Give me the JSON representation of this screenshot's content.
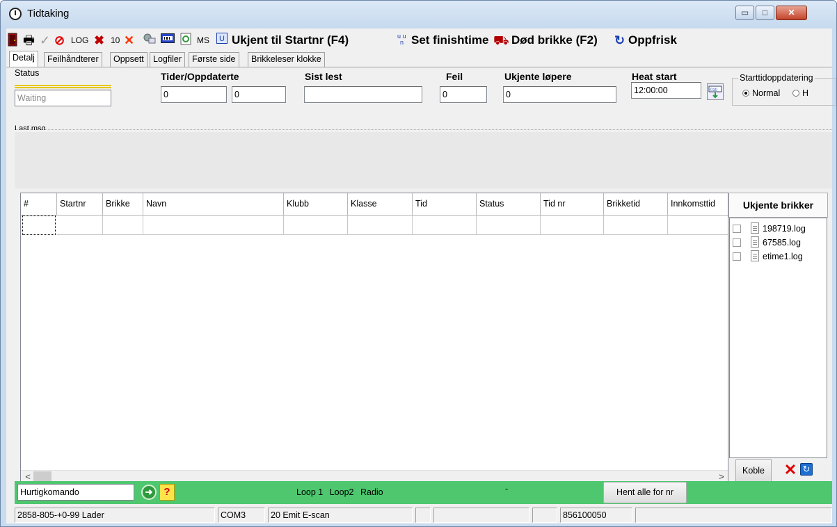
{
  "window": {
    "title": "Tidtaking",
    "controls": {
      "minimize": "▭",
      "maximize": "□",
      "close": "✕"
    }
  },
  "toolbar": {
    "log_label": "LOG",
    "ten_label": "10",
    "ms_label": "MS",
    "unknown_to_startnr_label": "Ukjent til Startnr (F4)",
    "set_finishtime_label": "Set finishtime",
    "dead_tag_label": "Død brikke (F2)",
    "refresh_label": "Oppfrisk",
    "icons": [
      "door-icon",
      "printer-icon",
      "check-icon",
      "no-entry-icon",
      "x-mark-icon",
      "x-icon",
      "network-icon",
      "barcode-icon",
      "refresh-doc-icon",
      "u-box-icon",
      "finish-arrows-icon",
      "car-crash-icon",
      "refresh-arrow-icon"
    ],
    "accent_color": "#1a3fb0"
  },
  "tabs": [
    {
      "label": "Detalj",
      "active": true
    },
    {
      "label": "Feilhåndterer",
      "active": false
    },
    {
      "label": "Oppsett",
      "active": false
    },
    {
      "label": "Logfiler",
      "active": false
    },
    {
      "label": "Første side",
      "active": false
    },
    {
      "label": "Brikkeleser klokke",
      "active": false
    }
  ],
  "status_panel": {
    "status_label": "Status",
    "status_value": "Waiting",
    "times_label": "Tider/Oppdaterte",
    "times_value": "0",
    "updated_value": "0",
    "last_read_label": "Sist lest",
    "last_read_value": "",
    "error_label": "Feil",
    "error_value": "0",
    "unknown_runners_label": "Ukjente løpere",
    "unknown_runners_value": "0",
    "heat_start_label": "Heat start",
    "heat_start_value": "12:00:00",
    "start_update_group_label": "Starttidoppdatering",
    "radio_normal": "Normal",
    "radio_other": "H",
    "last_msg_label": "Last msg"
  },
  "grid": {
    "columns": [
      "#",
      "Startnr",
      "Brikke",
      "Navn",
      "Klubb",
      "Klasse",
      "Tid",
      "Status",
      "Tid nr",
      "Brikketid",
      "Innkomsttid"
    ],
    "rows": [
      [
        "",
        "",
        "",
        "",
        "",
        "",
        "",
        "",
        "",
        "",
        ""
      ]
    ]
  },
  "unknown_tags": {
    "header": "Ukjente brikker",
    "files": [
      "198719.log",
      "67585.log",
      "etime1.log"
    ],
    "connect_label": "Koble"
  },
  "command_bar": {
    "input_value": "Hurtigkomando",
    "loops": [
      "Loop 1",
      "Loop2",
      "Radio"
    ],
    "dash": "-",
    "fetch_all_label": "Hent alle for nr",
    "bar_color": "#4ec76f"
  },
  "statusbar": {
    "cells": [
      "2858-805-+0-99 Lader",
      "COM3",
      "20 Emit E-scan",
      "",
      "",
      "",
      "856100050",
      ""
    ]
  }
}
